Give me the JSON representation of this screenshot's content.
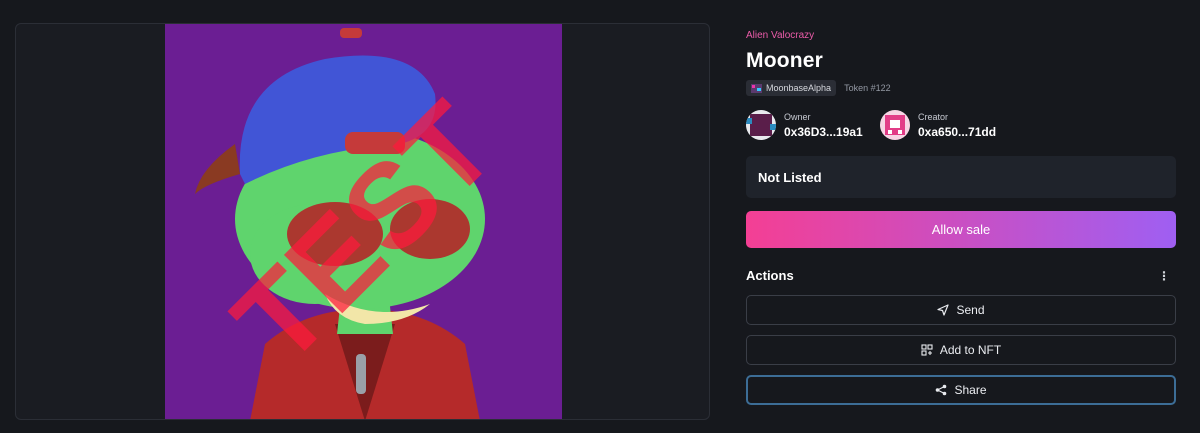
{
  "nft": {
    "collection": "Alien Valocrazy",
    "name": "Mooner",
    "chain": "MoonbaseAlpha",
    "token": "Token #122",
    "watermark": "TEST"
  },
  "owner": {
    "label": "Owner",
    "address": "0x36D3...19a1"
  },
  "creator": {
    "label": "Creator",
    "address": "0xa650...71dd"
  },
  "listing": {
    "status": "Not Listed"
  },
  "sale_button": "Allow sale",
  "actions": {
    "title": "Actions",
    "menu_icon": "⋮",
    "send": "Send",
    "add_to_nft": "Add to NFT",
    "share": "Share"
  },
  "colors": {
    "accent_start": "#f43f94",
    "accent_end": "#9f5ff2",
    "collection_pink": "#ec5ca9",
    "art_background": "#6b1e93"
  }
}
